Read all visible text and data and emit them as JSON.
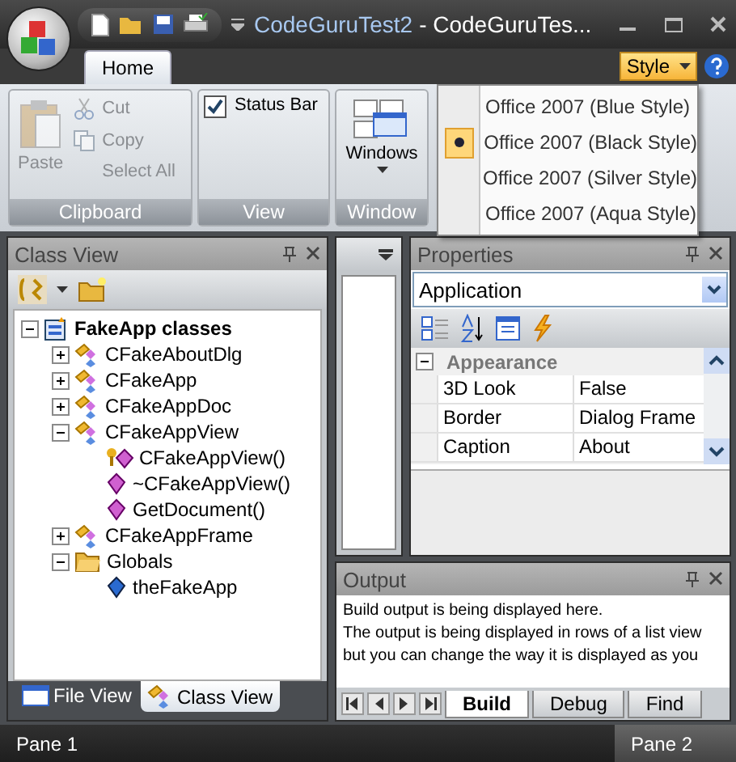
{
  "window": {
    "document": "CodeGuruTest2",
    "app": "- CodeGuruTes..."
  },
  "ribbon_tabs": [
    {
      "label": "Home",
      "selected": true
    }
  ],
  "style_button": {
    "label": "Style"
  },
  "style_menu": [
    {
      "label": "Office 2007 (Blue Style)",
      "selected": false
    },
    {
      "label": "Office 2007 (Black Style)",
      "selected": true
    },
    {
      "label": "Office 2007 (Silver Style)",
      "selected": false
    },
    {
      "label": "Office 2007 (Aqua Style)",
      "selected": false
    }
  ],
  "groups": [
    {
      "label": "Clipboard",
      "kind": "clipboard",
      "big": {
        "label": "Paste",
        "disabled": true
      },
      "small": [
        {
          "label": "Cut",
          "kind": "cut",
          "disabled": true
        },
        {
          "label": "Copy",
          "kind": "copy",
          "disabled": true
        },
        {
          "label": "Select All",
          "kind": "select_all",
          "disabled": true
        }
      ]
    },
    {
      "label": "View",
      "kind": "view",
      "checkbox": {
        "label": "Status Bar",
        "checked": true
      }
    },
    {
      "label": "Window",
      "kind": "window",
      "big": {
        "label": "Windows",
        "disabled": false
      }
    }
  ],
  "class_view": {
    "title": "Class View",
    "tree": [
      {
        "label": "FakeApp classes",
        "kind": "root",
        "expanded": true,
        "children": [
          {
            "label": "CFakeAboutDlg",
            "kind": "class",
            "expanded": false
          },
          {
            "label": "CFakeApp",
            "kind": "class",
            "expanded": false
          },
          {
            "label": "CFakeAppDoc",
            "kind": "class",
            "expanded": false
          },
          {
            "label": "CFakeAppView",
            "kind": "class",
            "expanded": true,
            "children": [
              {
                "label": "CFakeAppView()",
                "kind": "protected_method"
              },
              {
                "label": "~CFakeAppView()",
                "kind": "method"
              },
              {
                "label": "GetDocument()",
                "kind": "method"
              }
            ]
          },
          {
            "label": "CFakeAppFrame",
            "kind": "class",
            "expanded": false
          },
          {
            "label": "Globals",
            "kind": "folder",
            "expanded": true,
            "children": [
              {
                "label": "theFakeApp",
                "kind": "variable"
              }
            ]
          }
        ]
      }
    ],
    "tabs": [
      {
        "label": "File View",
        "selected": false
      },
      {
        "label": "Class View",
        "selected": true
      }
    ]
  },
  "properties": {
    "title": "Properties",
    "object": "Application",
    "category": {
      "label": "Appearance",
      "expanded": true
    },
    "rows": [
      {
        "name": "3D Look",
        "value": "False"
      },
      {
        "name": "Border",
        "value": "Dialog Frame"
      },
      {
        "name": "Caption",
        "value": "About"
      }
    ]
  },
  "output": {
    "title": "Output",
    "lines": [
      "Build output is being displayed here.",
      "The output is being displayed in rows of a list view",
      "but you can change the way it is displayed as you"
    ],
    "tabs": [
      {
        "label": "Build",
        "selected": true
      },
      {
        "label": "Debug",
        "selected": false
      },
      {
        "label": "Find",
        "selected": false
      }
    ]
  },
  "status_bar": [
    "Pane 1",
    "Pane 2"
  ]
}
